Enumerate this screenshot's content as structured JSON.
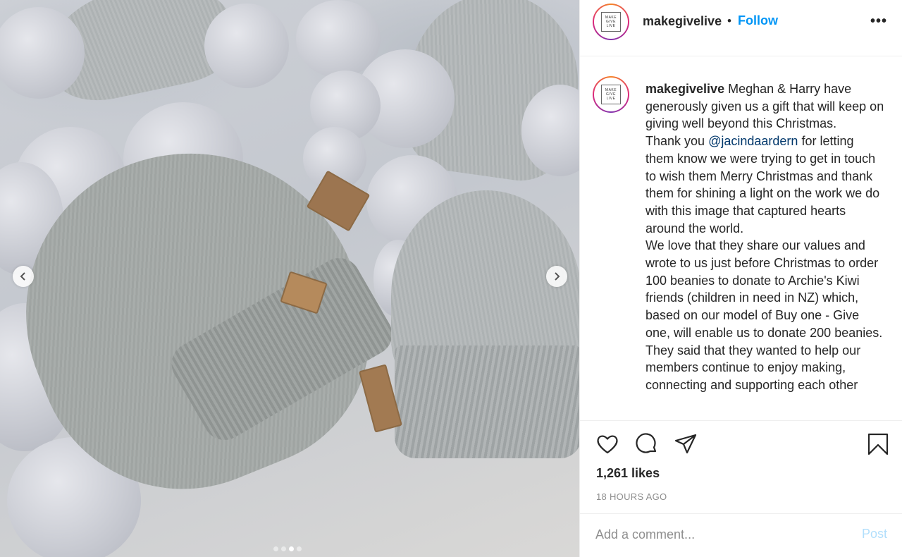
{
  "post": {
    "username": "makegivelive",
    "follow_label": "Follow",
    "separator": "•",
    "more_label": "•••",
    "avatar_logo": [
      "MAKE",
      "GIVE",
      "LIVE"
    ],
    "caption": {
      "username": "makegivelive",
      "paragraphs": [
        "Meghan & Harry have generously given us a gift that will keep on giving well beyond this Christmas.",
        "for letting them know we were trying to get in touch to wish them Merry Christmas and thank them for shining a light on the work we do with this image that captured hearts around the world.",
        "We love that they share our values and wrote to us just before Christmas to order 100 beanies to donate to Archie's Kiwi friends (children in need in NZ) which, based on our model of Buy one - Give one, will enable us to donate 200 beanies.",
        "They said that they wanted to help our members continue to enjoy making, connecting and supporting each other"
      ],
      "thank_you_prefix": "Thank you",
      "mention": "@jacindaardern"
    },
    "likes": "1,261 likes",
    "time": "18 HOURS AGO",
    "comment_placeholder": "Add a comment...",
    "post_label": "Post"
  },
  "carousel": {
    "slide_count": 4,
    "active_index": 2
  },
  "icons": {
    "like": "heart-icon",
    "comment": "comment-icon",
    "share": "paper-plane-icon",
    "save": "bookmark-icon",
    "prev": "chevron-left-icon",
    "next": "chevron-right-icon"
  },
  "colors": {
    "accent": "#0095f6",
    "mention": "#00376b",
    "muted": "#8e8e8e",
    "post_disabled": "#b2dffc"
  }
}
